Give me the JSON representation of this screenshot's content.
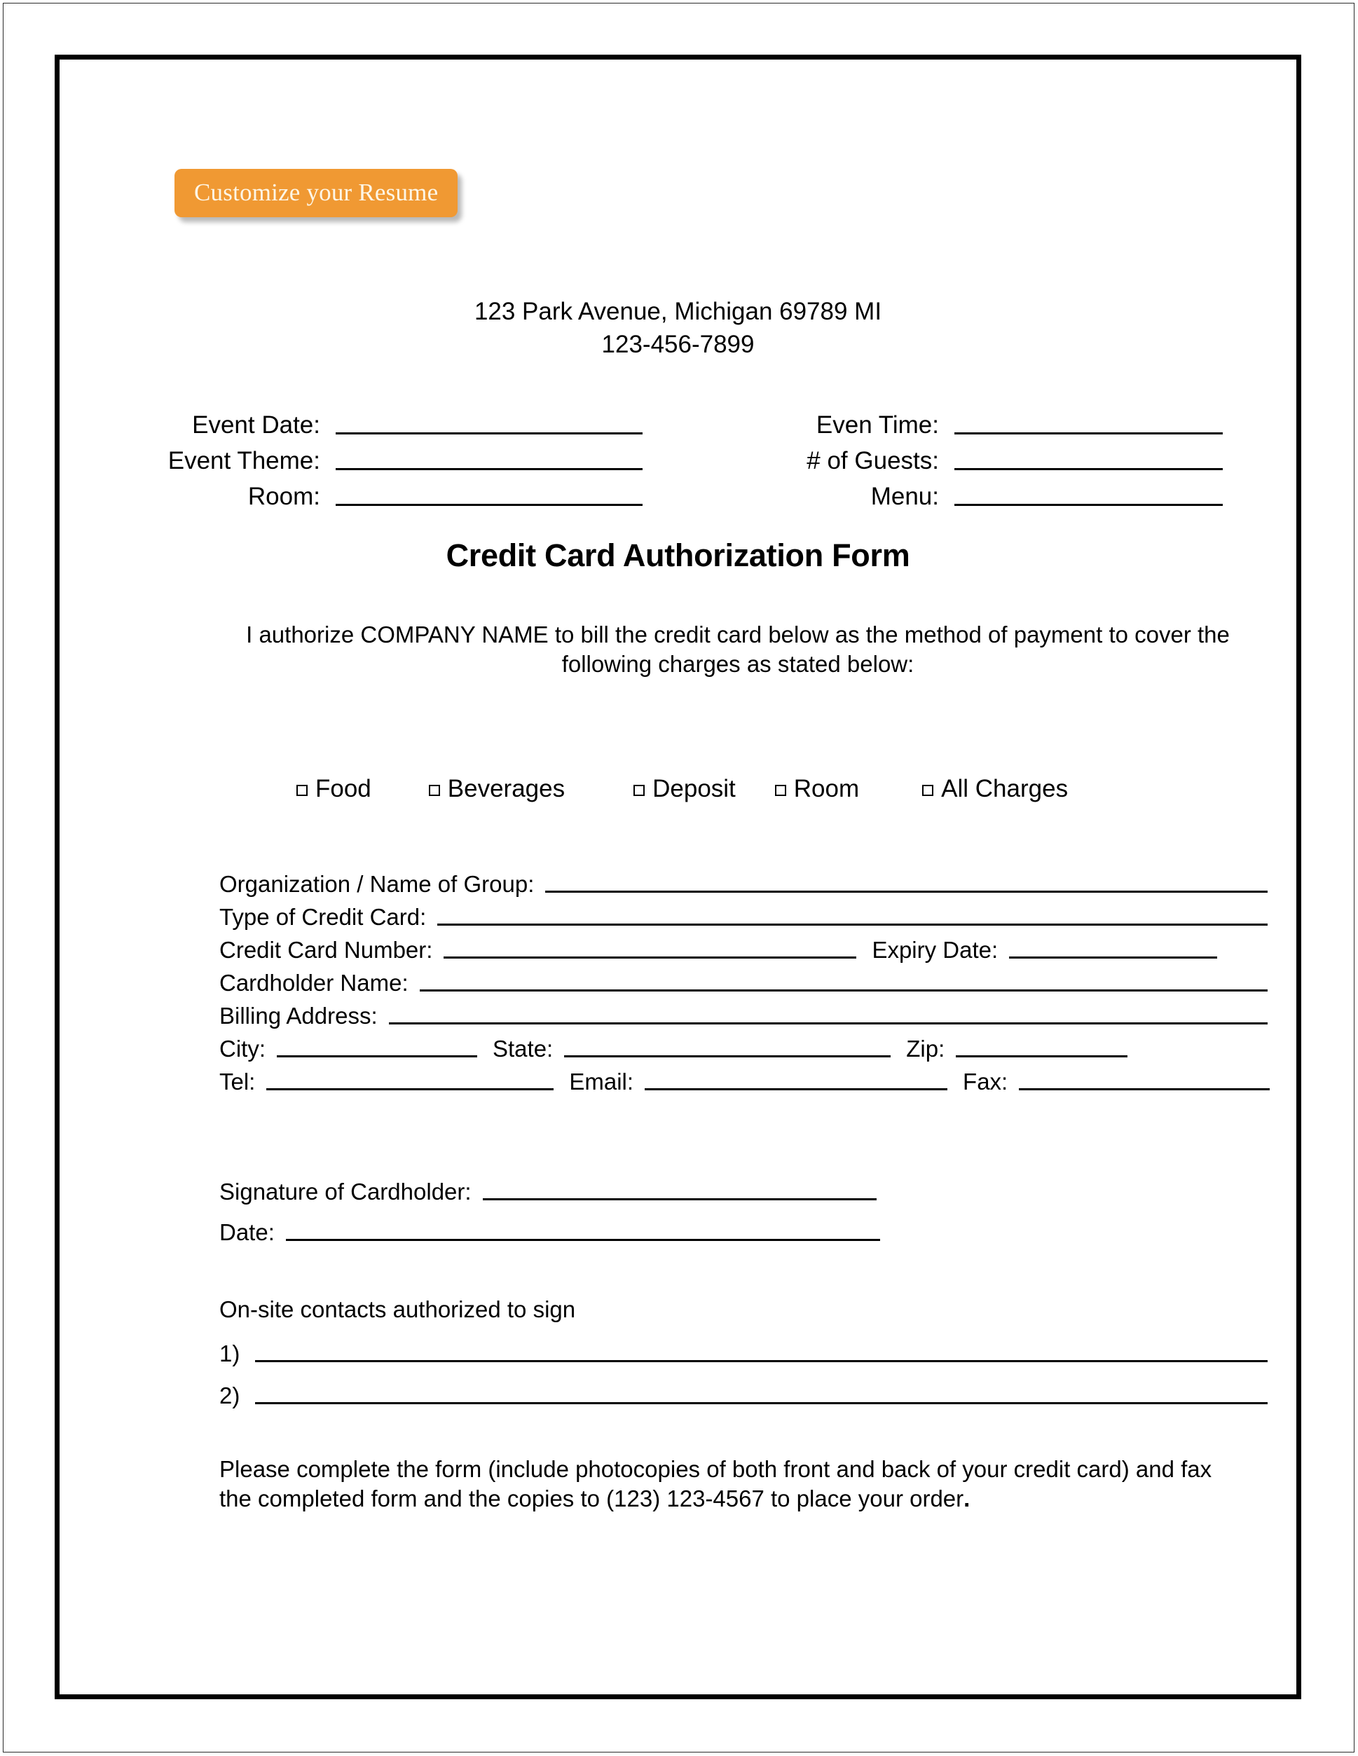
{
  "badge": {
    "label": "Customize your Resume",
    "bg_color": "#f09933",
    "text_color": "#fdf6e6"
  },
  "header": {
    "address": "123 Park Avenue, Michigan 69789 MI",
    "phone": "123-456-7899"
  },
  "event_details": {
    "rows": [
      {
        "left_label": "Event Date:",
        "right_label": "Even Time:"
      },
      {
        "left_label": "Event Theme:",
        "right_label": "# of Guests:"
      },
      {
        "left_label": "Room:",
        "right_label": "Menu:"
      }
    ]
  },
  "form": {
    "title": "Credit Card Authorization Form",
    "authorization_text": "I authorize COMPANY NAME to bill the credit card below as the method of payment to cover the following charges as stated below:"
  },
  "charges": {
    "options": [
      {
        "label": "Food"
      },
      {
        "label": "Beverages"
      },
      {
        "label": "Deposit"
      },
      {
        "label": "Room"
      },
      {
        "label": "All Charges"
      }
    ]
  },
  "card_fields": {
    "organization": "Organization / Name of Group:",
    "card_type": "Type of Credit Card:",
    "card_number": "Credit Card Number:",
    "expiry": "Expiry Date:",
    "cardholder_name": "Cardholder Name:",
    "billing_address": "Billing Address:",
    "city": "City:",
    "state": "State:",
    "zip": "Zip:",
    "tel": "Tel:",
    "email": "Email:",
    "fax": "Fax:"
  },
  "signature": {
    "signature_label": "Signature of Cardholder:",
    "date_label": "Date:"
  },
  "contacts": {
    "heading": "On-site contacts authorized to sign",
    "items": [
      {
        "number": "1)"
      },
      {
        "number": "2)"
      }
    ]
  },
  "closing": {
    "text": "Please complete the form (include photocopies of both front and back of your credit card) and fax the completed form and the copies to (123) 123-4567 to place your order",
    "period": "."
  }
}
